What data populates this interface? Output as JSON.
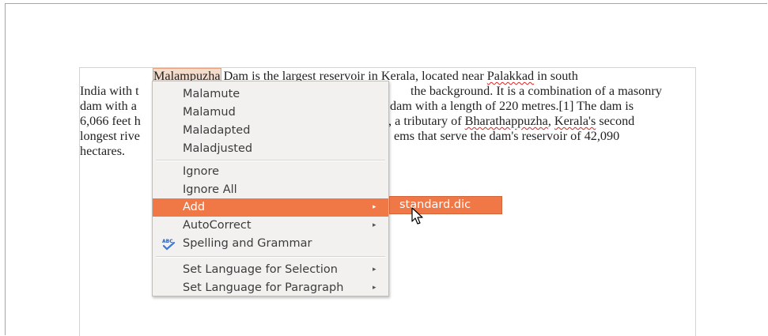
{
  "document": {
    "lines": [
      [
        "",
        "Malampuzha",
        " Dam is the largest reservoir in Kerala, located near ",
        "Palakkad",
        " in south"
      ],
      [
        "India with t",
        "",
        "",
        "",
        " the background. It is a combination of a masonry"
      ],
      [
        "dam with a ",
        "",
        "",
        "",
        "dam with a length of 220 metres.[1] The dam is"
      ],
      [
        "6,066 feet h",
        "",
        ", a tributary of ",
        "Bharathappuzha",
        ", Kerala's second"
      ],
      [
        "longest rive",
        "",
        "",
        "",
        "ems that serve the dam's reservoir of 42,090"
      ],
      [
        "hectares.",
        "",
        "",
        "",
        ""
      ]
    ],
    "line0_a": "Malampuzha",
    "line0_b": " Dam is the largest reservoir in Kerala, located near ",
    "line0_c": "Palakkad",
    "line0_d": " in south",
    "line1_left": "India with t",
    "line1_right": "the background. It is a combination of a masonry",
    "line2_left": "dam with a",
    "line2_right": "dam with a length of 220 metres.[1] The dam is",
    "line3_left": "6,066 feet h",
    "line3_right_a": ", a tributary of ",
    "line3_right_b": "Bharathappuzha",
    "line3_right_c": ", ",
    "line3_right_d": "Kerala's",
    "line3_right_e": " second",
    "line4_left": "longest rive",
    "line4_right": "ems that serve the dam's reservoir of 42,090",
    "line5": "hectares."
  },
  "context_menu": {
    "suggestions": [
      "Malamute",
      "Malamud",
      "Maladapted",
      "Maladjusted"
    ],
    "ignore": "Ignore",
    "ignore_all": "Ignore All",
    "add": "Add",
    "autocorrect": "AutoCorrect",
    "spelling_grammar": "Spelling and Grammar",
    "set_lang_selection": "Set Language for Selection",
    "set_lang_paragraph": "Set Language for Paragraph",
    "submenu_arrow": "▸"
  },
  "add_submenu": {
    "item": "standard.dic"
  },
  "colors": {
    "highlight": "#f07746",
    "menu_bg": "#f2f1f0",
    "spell_underline": "#d22222"
  },
  "icons": {
    "spelling": "abc-check-icon",
    "cursor": "mouse-pointer-icon"
  }
}
